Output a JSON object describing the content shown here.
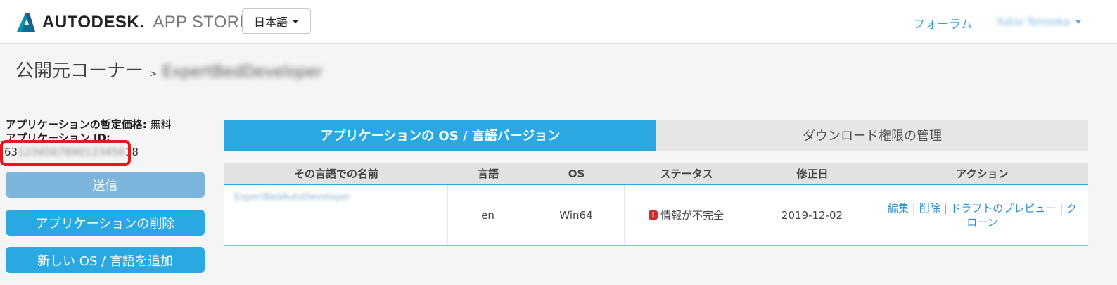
{
  "header": {
    "brand": "AUTODESK.",
    "store": "APP STORE",
    "language_label": "日本語",
    "forum_label": "フォーラム",
    "user_name": "Yukio Tonooka"
  },
  "breadcrumb": {
    "root": "公開元コーナー",
    "separator": ">",
    "current": "ExpertBedDeveloper"
  },
  "info": {
    "price_label": "アプリケーションの暫定価格:",
    "price_value": "無料",
    "id_label": "アプリケーション ID:",
    "id_prefix": "63",
    "id_masked": "1234567890123456",
    "id_suffix": "18"
  },
  "buttons": {
    "send": "送信",
    "delete_app": "アプリケーションの削除",
    "add_os_language": "新しい OS / 言語を追加"
  },
  "tabs": [
    {
      "label": "アプリケーションの OS / 言語バージョン",
      "active": true
    },
    {
      "label": "ダウンロード権限の管理",
      "active": false
    }
  ],
  "table": {
    "headers": [
      "その言語での名前",
      "言語",
      "OS",
      "ステータス",
      "修正日",
      "アクション"
    ],
    "rows": [
      {
        "name": "ExpertBedAutoDeveloper",
        "language": "en",
        "os": "Win64",
        "status": "情報が不完全",
        "modified": "2019-12-02",
        "actions": {
          "edit": "編集",
          "delete": "削除",
          "draft_preview": "ドラフトのプレビュー",
          "clone": "クローン",
          "sep": " | "
        }
      }
    ]
  },
  "colors": {
    "accent": "#2aa8e1",
    "send_button": "#7bb5db",
    "highlight": "#e3191f",
    "status_error": "#c9302c",
    "link": "#2a8fd0"
  }
}
